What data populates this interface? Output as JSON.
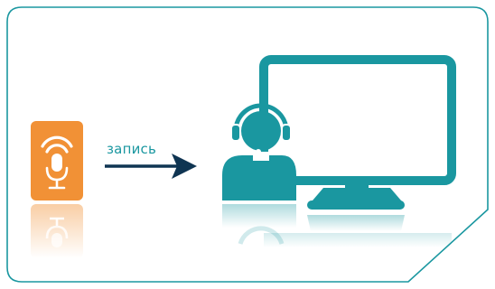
{
  "labels": {
    "arrow_caption": "запись"
  },
  "colors": {
    "frame": "#1a97a0",
    "accent_teal": "#1a97a0",
    "mic_tile": "#f19136",
    "arrow": "#0f3552",
    "background": "#ffffff"
  },
  "icons": {
    "source": "microphone-broadcast-icon",
    "operator": "headset-operator-icon",
    "screen": "computer-monitor-icon",
    "connector": "arrow-right-icon"
  }
}
